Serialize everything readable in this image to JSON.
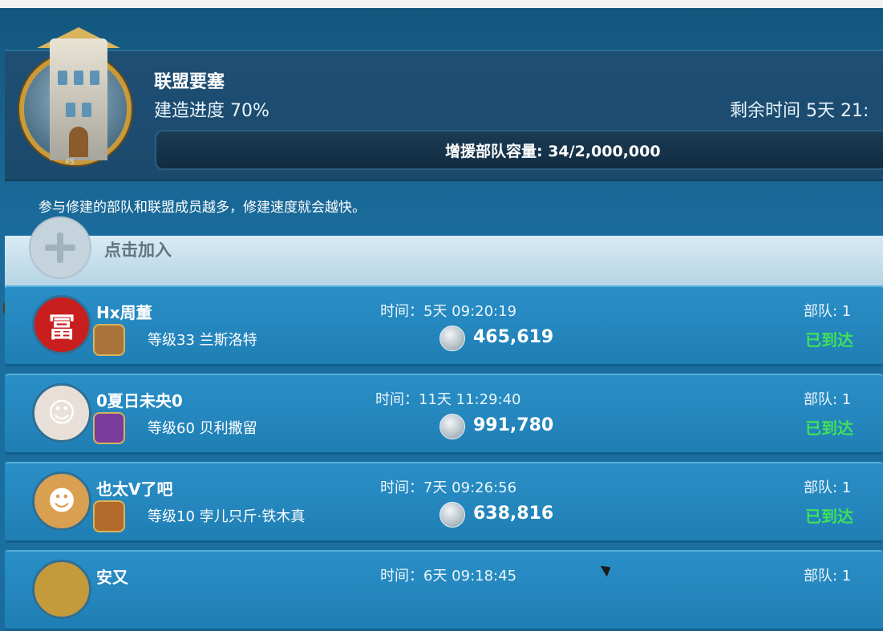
{
  "header": {
    "title": "联盟要塞",
    "progress_label": "建造进度 70%",
    "progress_value": 0.7,
    "remaining_label": "剩余时间 5天 21:",
    "capacity_text": "增援部队容量: 34/2,000,000",
    "capacity_fill": 1.7e-05,
    "level_tag": "F5",
    "hint": "参与修建的部队和联盟成员越多，修建速度就会越快。"
  },
  "join": {
    "label": "点击加入"
  },
  "rows": [
    {
      "name": "Hx周董",
      "level": "等级33 兰斯洛特",
      "time": "时间：5天 09:20:19",
      "troops": "465,619",
      "units": "部队: 1",
      "status": "已到达",
      "avatar_glyph": "冨",
      "avatar_color": "#c81e1e",
      "commander_color": "#a8743a"
    },
    {
      "name": "0夏日未央0",
      "level": "等级60 贝利撒留",
      "time": "时间：11天 11:29:40",
      "troops": "991,780",
      "units": "部队: 1",
      "status": "已到达",
      "avatar_glyph": "☺",
      "avatar_color": "#e8e0d8",
      "commander_color": "#7a3c9a"
    },
    {
      "name": "也太V了吧",
      "level": "等级10 孛儿只斤·铁木真",
      "time": "时间：7天 09:26:56",
      "troops": "638,816",
      "units": "部队: 1",
      "status": "已到达",
      "avatar_glyph": "☻",
      "avatar_color": "#d8a050",
      "commander_color": "#b36a2a"
    },
    {
      "name": "安又",
      "level": "",
      "time": "时间：6天 09:18:45",
      "troops": "",
      "units": "部队: 1",
      "status": "",
      "avatar_glyph": "",
      "avatar_color": "#c49a3a",
      "commander_color": "#b36a2a"
    }
  ],
  "colors": {
    "panel": "#1a6c9c",
    "row": "#2a8fc7",
    "status_green": "#3fe05a",
    "gold": "#c99a3b"
  }
}
